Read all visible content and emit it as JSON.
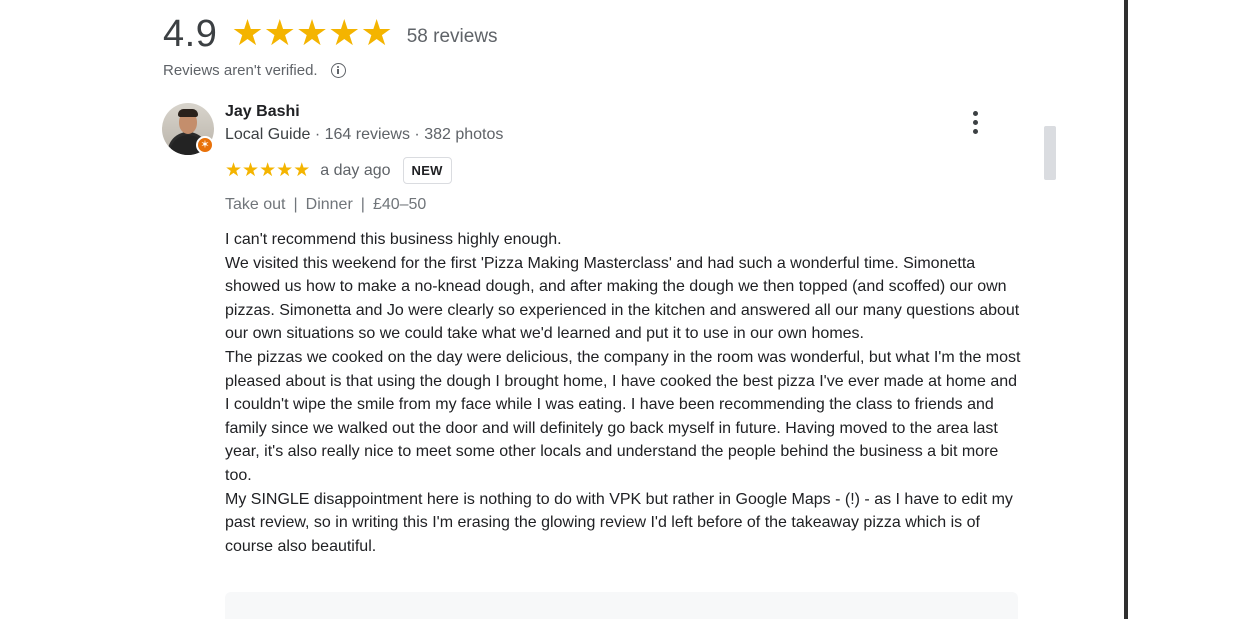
{
  "summary": {
    "score": "4.9",
    "stars": [
      "★",
      "★",
      "★",
      "★",
      "★"
    ],
    "rating_value": 4.9,
    "total_reviews": "58 reviews",
    "verification_note": "Reviews aren't verified."
  },
  "review": {
    "author_name": "Jay Bashi",
    "author_badge_label": "Local Guide",
    "author_stats": " · 164 reviews · 382 photos",
    "star_glyphs": [
      "★",
      "★",
      "★",
      "★",
      "★"
    ],
    "rating_value": 5,
    "date": "a day ago",
    "new_label": "NEW",
    "attributes": [
      "Take out",
      "Dinner",
      "£40–50"
    ],
    "attribute_separator": "|",
    "paragraphs": [
      "I can't recommend this business highly enough.",
      "We visited this weekend for the first 'Pizza Making Masterclass' and had such a wonderful time. Simonetta showed us how to make a no-knead dough, and after making the dough we then topped (and scoffed) our own pizzas. Simonetta and Jo were clearly so experienced in the kitchen and answered all our many questions about our own situations so we could take what we'd learned and put it to use in our own homes.",
      "The pizzas we cooked on the day were delicious, the company in the room was wonderful, but what I'm the most pleased about is that using the dough I brought home, I have cooked the best pizza I've ever made at home and I couldn't wipe the smile from my face while I was eating. I have been recommending the class to friends and family since we walked out the door and will definitely go back myself in future. Having moved to the area last year, it's also really nice to meet some other locals and understand the people behind the business a bit more too.",
      "My SINGLE disappointment here is nothing to do with VPK but rather in Google Maps - (!) - as I have to edit my past review, so in writing this I'm erasing the glowing review I'd left before of the takeaway pizza which is of course also beautiful."
    ]
  },
  "icons": {
    "info": "info-icon",
    "more": "more-vert-icon",
    "guide_badge": "local-guide-star-icon",
    "guide_badge_glyph": "✶"
  },
  "colors": {
    "star": "#f4b400",
    "guide_badge": "#e8710a",
    "text_primary": "#202124",
    "text_secondary": "#5f6368"
  }
}
